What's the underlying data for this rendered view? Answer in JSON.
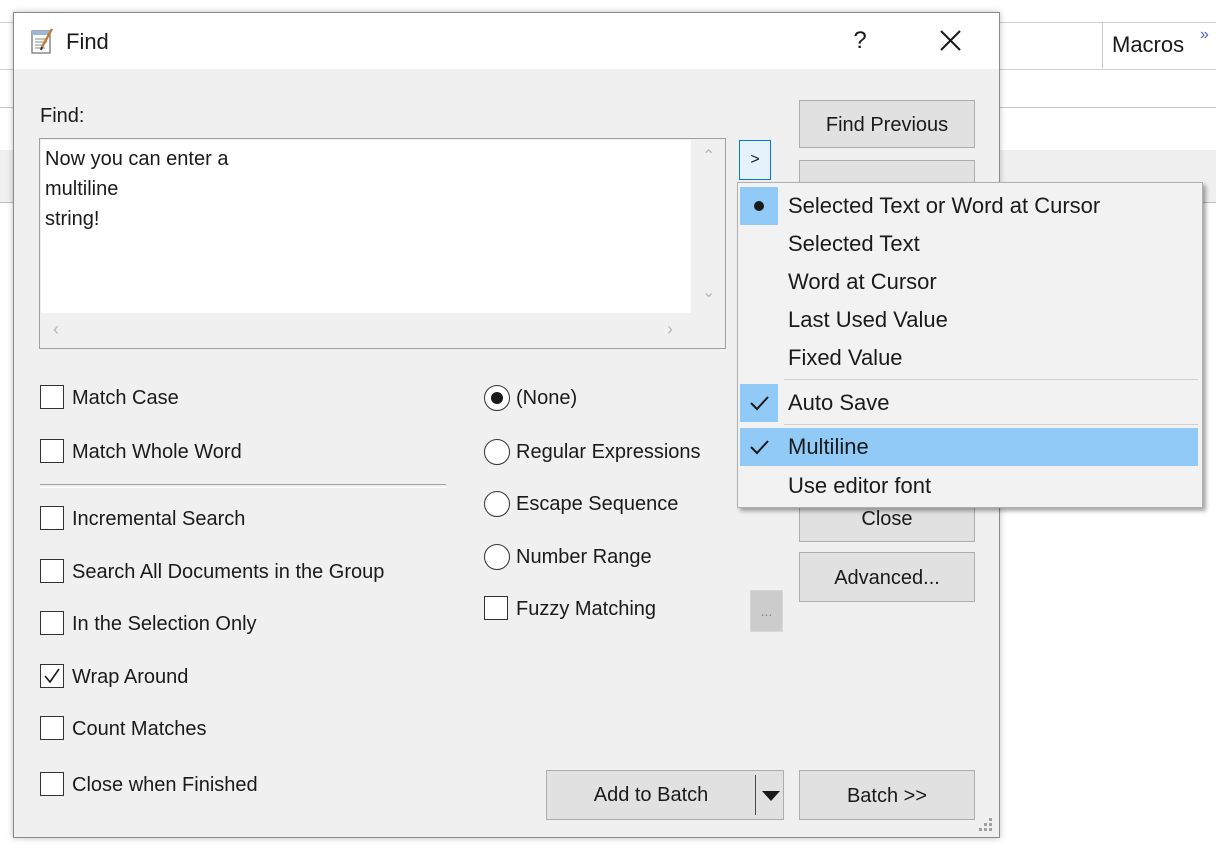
{
  "background": {
    "toolbar_label": "Macros",
    "chevron": "»"
  },
  "dialog": {
    "title": "Find",
    "help_label": "?",
    "find_label": "Find:",
    "find_lines": [
      "Now you can enter a",
      "multiline",
      "string!"
    ],
    "more_button": ">",
    "buttons": {
      "find_previous": "Find Previous",
      "close": "Close",
      "advanced": "Advanced...",
      "add_to_batch": "Add to Batch",
      "batch": "Batch >>",
      "ellipsis": "..."
    },
    "checkboxes": {
      "match_case": {
        "label": "Match Case",
        "checked": false
      },
      "match_whole_word": {
        "label": "Match Whole Word",
        "checked": false
      },
      "incremental_search": {
        "label": "Incremental Search",
        "checked": false
      },
      "search_all_documents": {
        "label": "Search All Documents in the Group",
        "checked": false
      },
      "in_selection_only": {
        "label": "In the Selection Only",
        "checked": false
      },
      "wrap_around": {
        "label": "Wrap Around",
        "checked": true
      },
      "count_matches": {
        "label": "Count Matches",
        "checked": false
      },
      "close_when_finished": {
        "label": "Close when Finished",
        "checked": false
      },
      "fuzzy_matching": {
        "label": "Fuzzy Matching",
        "checked": false
      }
    },
    "radios": {
      "none": {
        "label": "(None)",
        "selected": true
      },
      "regex": {
        "label": "Regular Expressions",
        "selected": false
      },
      "escape": {
        "label": "Escape Sequence",
        "selected": false
      },
      "number_range": {
        "label": "Number Range",
        "selected": false
      }
    }
  },
  "menu": {
    "items": [
      {
        "label": "Selected Text or Word at Cursor",
        "mark": "bullet"
      },
      {
        "label": "Selected Text",
        "mark": ""
      },
      {
        "label": "Word at Cursor",
        "mark": ""
      },
      {
        "label": "Last Used Value",
        "mark": ""
      },
      {
        "label": "Fixed Value",
        "mark": ""
      },
      {
        "label": "Auto Save",
        "mark": "check"
      },
      {
        "label": "Multiline",
        "mark": "check",
        "highlighted": true
      },
      {
        "label": "Use editor font",
        "mark": ""
      }
    ]
  },
  "colors": {
    "dialog_bg": "#f0f0f0",
    "highlight": "#91c9f7",
    "accent": "#0078d7"
  }
}
